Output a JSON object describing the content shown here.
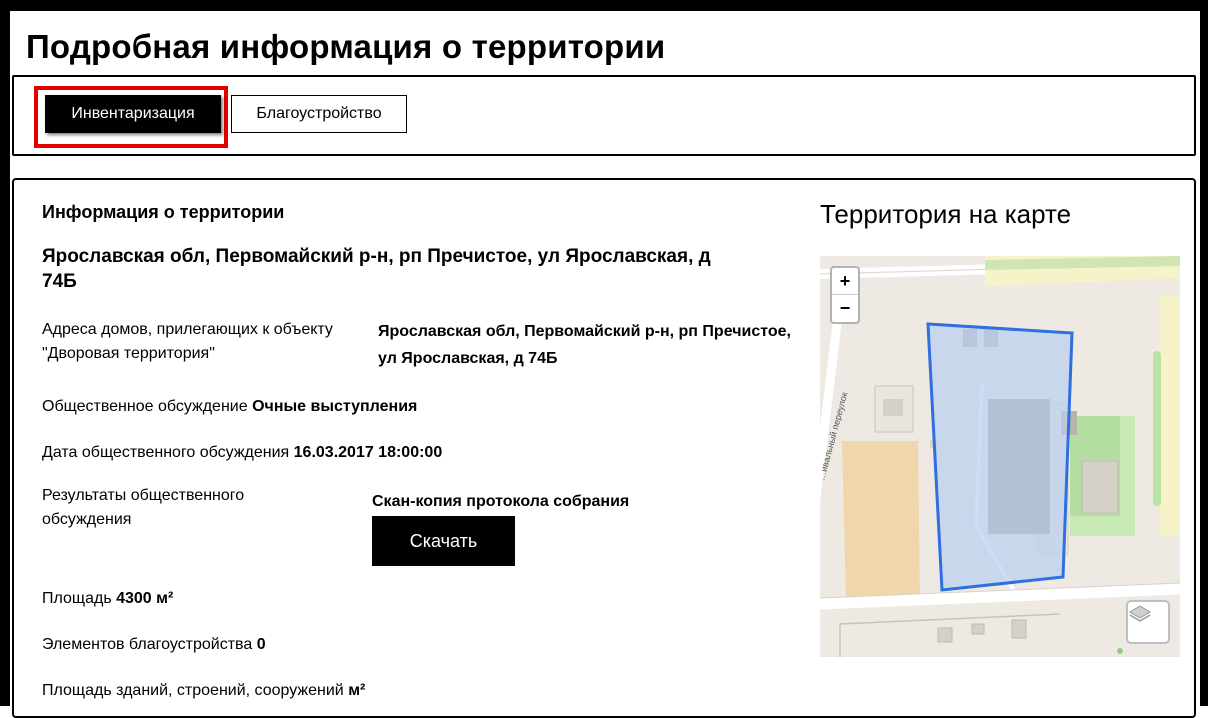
{
  "page": {
    "title": "Подробная информация о территории"
  },
  "tabs": [
    {
      "label": "Инвентаризация",
      "active": true
    },
    {
      "label": "Благоустройство",
      "active": false
    }
  ],
  "info": {
    "heading": "Информация о территории",
    "address": "Ярославская обл, Первомайский р-н, рп Пречистое, ул Ярославская, д 74Б",
    "adjacent_houses": {
      "label": "Адреса домов, прилегающих к объекту \"Дворовая территория\"",
      "value": "Ярославская обл, Первомайский р-н, рп Пречистое, ул Ярославская, д 74Б"
    },
    "public_discussion": {
      "label": "Общественное обсуждение",
      "value": "Очные выступления"
    },
    "discussion_date": {
      "label": "Дата общественного обсуждения",
      "value": "16.03.2017 18:00:00"
    },
    "discussion_results": {
      "label": "Результаты общественного обсуждения",
      "value": "Скан-копия протокола собрания",
      "button_label": "Скачать"
    },
    "area": {
      "label": "Площадь",
      "value": "4300 м²"
    },
    "improvement_elements": {
      "label": "Элементов благоустройства",
      "value": "0"
    },
    "buildings_area": {
      "label": "Площадь зданий, строений, сооружений",
      "value": "м²"
    }
  },
  "map": {
    "title": "Территория на карте",
    "zoom_in": "+",
    "zoom_out": "−",
    "street_label": "…ивальный переулок",
    "polygon_color": "#2f6fe0",
    "polygon_fill": "#b9cff0"
  },
  "colors": {
    "highlight": "#e00000",
    "active_tab": "#000000"
  }
}
